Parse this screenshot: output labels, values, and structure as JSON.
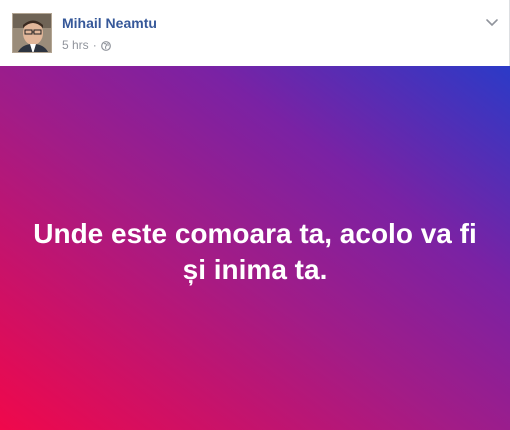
{
  "post": {
    "author": "Mihail Neamtu",
    "time": "5 hrs",
    "separator": "·",
    "privacy_icon": "globe-icon",
    "menu_icon": "chevron-down-icon",
    "text": "Unde este comoara ta, acolo va fi și inima ta.",
    "background_colors": [
      "#f0084b",
      "#a21c87",
      "#7a22a4",
      "#2b3ac7"
    ],
    "author_color": "#365899"
  }
}
